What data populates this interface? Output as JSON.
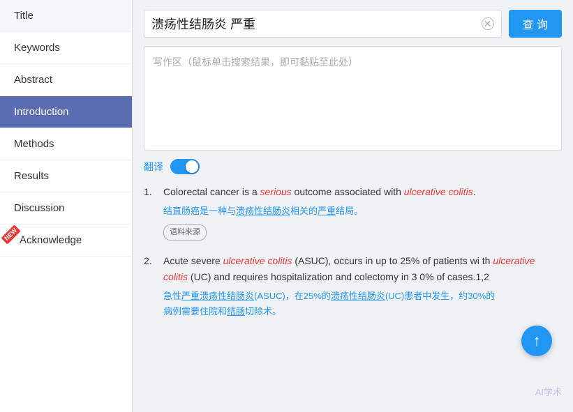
{
  "sidebar": {
    "items": [
      {
        "id": "title",
        "label": "Title",
        "active": false,
        "new_badge": false
      },
      {
        "id": "keywords",
        "label": "Keywords",
        "active": false,
        "new_badge": false
      },
      {
        "id": "abstract",
        "label": "Abstract",
        "active": false,
        "new_badge": false
      },
      {
        "id": "introduction",
        "label": "Introduction",
        "active": true,
        "new_badge": false
      },
      {
        "id": "methods",
        "label": "Methods",
        "active": false,
        "new_badge": false
      },
      {
        "id": "results",
        "label": "Results",
        "active": false,
        "new_badge": false
      },
      {
        "id": "discussion",
        "label": "Discussion",
        "active": false,
        "new_badge": false
      },
      {
        "id": "acknowledge",
        "label": "Acknowledge",
        "active": false,
        "new_badge": true
      }
    ]
  },
  "search": {
    "query": "溃疡性结肠炎 严重",
    "button_label": "查 询",
    "placeholder": "写作区（鼠标单击搜索结果，即可黏贴至此处）"
  },
  "translate": {
    "label": "翻译",
    "enabled": true
  },
  "results": [
    {
      "num": "1.",
      "en_parts": [
        {
          "text": "Colorectal cancer is a ",
          "style": "normal"
        },
        {
          "text": "serious",
          "style": "italic-red"
        },
        {
          "text": " outcome associated with ",
          "style": "normal"
        },
        {
          "text": "ulcerative colitis",
          "style": "italic-red"
        },
        {
          "text": ".",
          "style": "normal"
        }
      ],
      "cn": "结直肠癌是一种与溃疡性结肠炎相关的严重结局。",
      "source_tag": "语料来源"
    },
    {
      "num": "2.",
      "en_parts": [
        {
          "text": "Acute severe ",
          "style": "normal"
        },
        {
          "text": "ulcerative colitis",
          "style": "italic-red"
        },
        {
          "text": " (ASUC), occurs in up to 25% of patients with ",
          "style": "normal"
        },
        {
          "text": "ulcerative colitis",
          "style": "italic-red"
        },
        {
          "text": " (UC) and requires hospitalization and colectomy in 30% of cases.1,2",
          "style": "normal"
        }
      ],
      "cn": "急性严重溃疡性结肠炎(ASUC)，在25%的溃疡性结肠炎(UC)患者中发生，约30%的病例需要住院和结肠切除术。",
      "source_tag": ""
    }
  ],
  "watermark": "AI学术"
}
